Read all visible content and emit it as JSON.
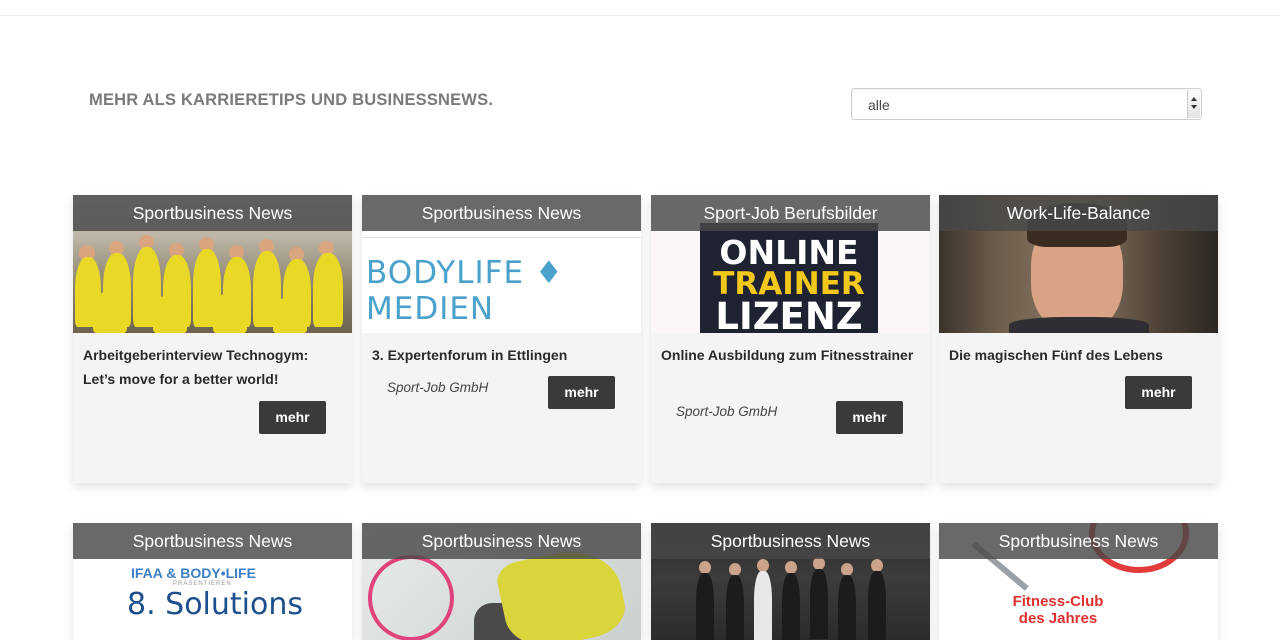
{
  "page": {
    "headline": "MEHR ALS KARRIERETIPS UND BUSINESSNEWS.",
    "filter": {
      "selected": "alle"
    }
  },
  "cards": [
    {
      "category": "Sportbusiness News",
      "title": "Arbeitgeberinterview Technogym: Let’s move for a better world!",
      "author": "",
      "button": "mehr"
    },
    {
      "category": "Sportbusiness News",
      "title": "3. Expertenforum in Ettlingen",
      "author": "Sport-Job GmbH",
      "button": "mehr",
      "image_text": "BODYLIFE ♦ MEDIEN"
    },
    {
      "category": "Sport-Job Berufsbilder",
      "title": "Online Ausbildung zum Fitnesstrainer",
      "author": "Sport-Job GmbH",
      "button": "mehr",
      "image_text": [
        "ONLINE",
        "TRAINER",
        "LIZENZ"
      ]
    },
    {
      "category": "Work-Life-Balance",
      "title": "Die magischen Fünf des Lebens",
      "author": "",
      "button": "mehr"
    },
    {
      "category": "Sportbusiness News",
      "image_text": {
        "brand": "IFAA & BODY•LIFE",
        "sub": "PRÄSENTIEREN",
        "main": "8. Solutions"
      }
    },
    {
      "category": "Sportbusiness News"
    },
    {
      "category": "Sportbusiness News"
    },
    {
      "category": "Sportbusiness News",
      "image_text": [
        "Fitness-Club",
        "des Jahres"
      ]
    }
  ]
}
